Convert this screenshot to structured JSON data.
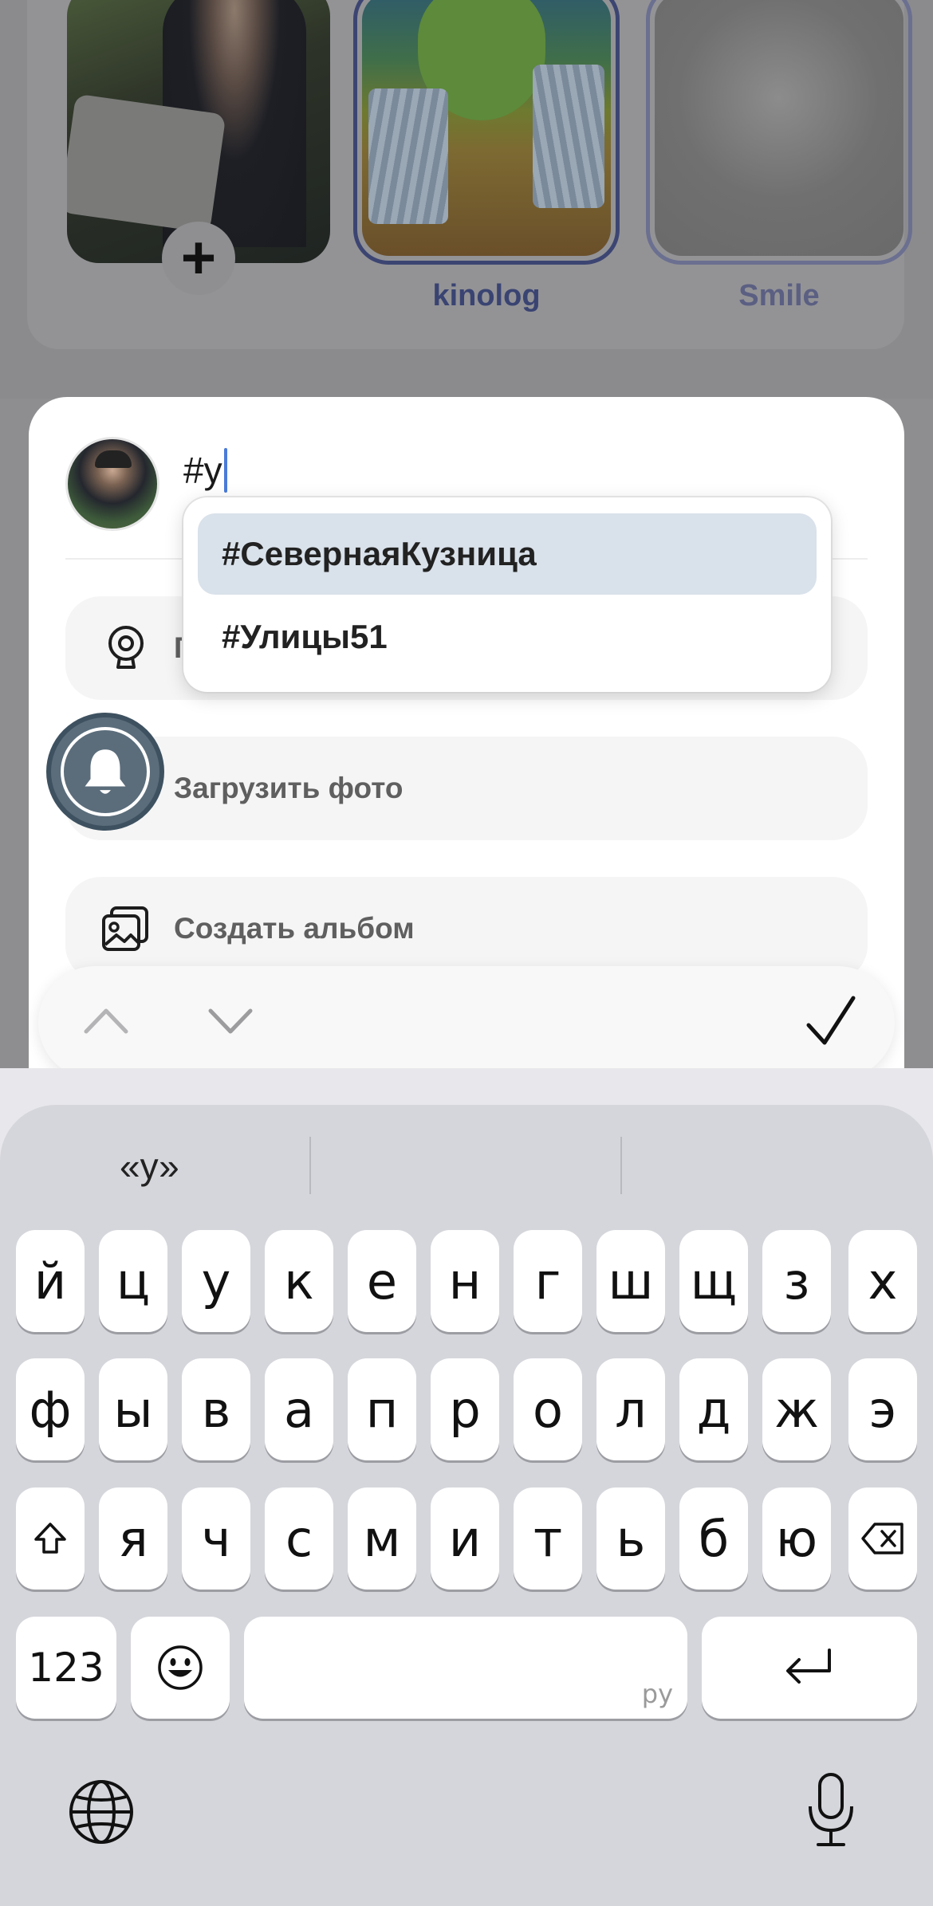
{
  "stories": {
    "self_add_label": "+",
    "items": [
      {
        "name": "kinolog"
      },
      {
        "name": "Smile"
      }
    ]
  },
  "composer": {
    "text": "#у",
    "hashtag_suggestions": [
      "#СевернаяКузница",
      "#Улицы51"
    ],
    "options": {
      "location_label": "Г",
      "upload_photo_label": "Загрузить фото",
      "create_album_label": "Создать альбом"
    }
  },
  "keyboard": {
    "suggestions": [
      "«у»",
      "",
      ""
    ],
    "rows": [
      [
        "й",
        "ц",
        "у",
        "к",
        "е",
        "н",
        "г",
        "ш",
        "щ",
        "з",
        "х"
      ],
      [
        "ф",
        "ы",
        "в",
        "а",
        "п",
        "р",
        "о",
        "л",
        "д",
        "ж",
        "э"
      ],
      [
        "я",
        "ч",
        "с",
        "м",
        "и",
        "т",
        "ь",
        "б",
        "ю"
      ]
    ],
    "numbers_key": "123",
    "space_lang_label": "ру"
  },
  "colors": {
    "story_label_primary": "#3a4472",
    "dropdown_selected": "#d9e1ea",
    "bell_button": "#5b6d7b"
  }
}
